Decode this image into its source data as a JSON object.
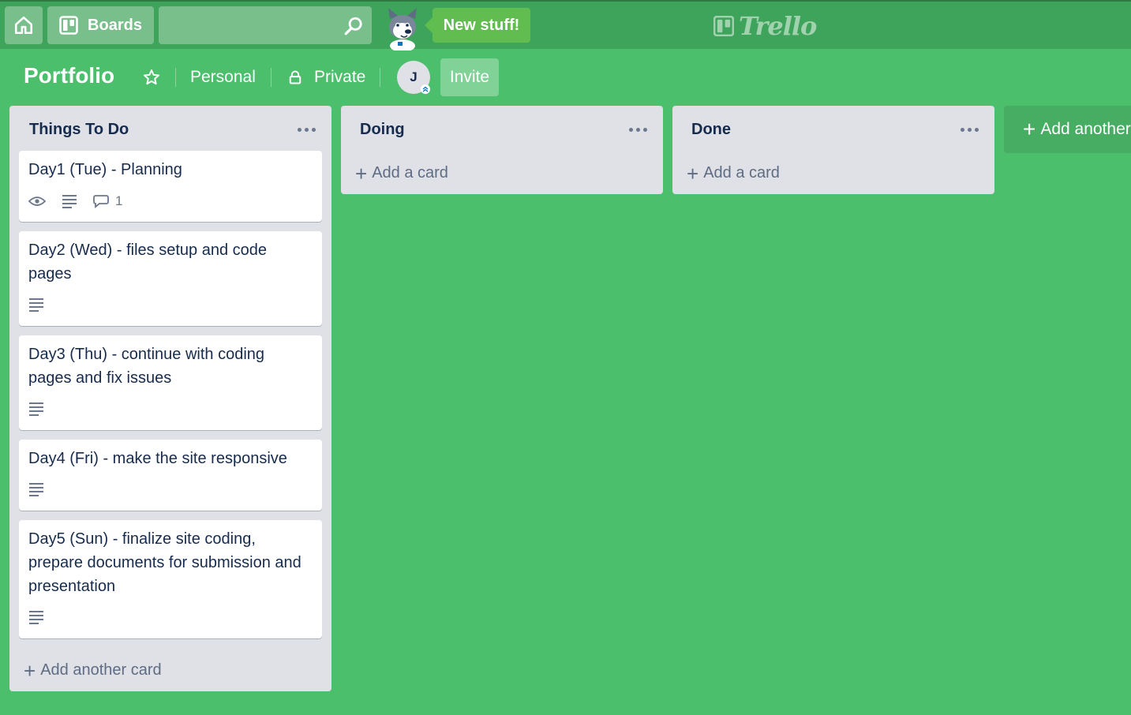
{
  "header": {
    "home_icon": "home-icon",
    "boards_label": "Boards",
    "search_placeholder": "",
    "new_stuff_label": "New stuff!",
    "logo_text": "Trello"
  },
  "board": {
    "title": "Portfolio",
    "team": "Personal",
    "visibility": "Private",
    "member_initial": "J",
    "invite_label": "Invite"
  },
  "lists": [
    {
      "title": "Things To Do",
      "cards": [
        {
          "title": "Day1 (Tue) - Planning",
          "badges": [
            "watch",
            "description",
            "comments"
          ],
          "comment_count": "1"
        },
        {
          "title": "Day2 (Wed) - files setup and code pages",
          "badges": [
            "description"
          ]
        },
        {
          "title": "Day3 (Thu) - continue with coding pages and fix issues",
          "badges": [
            "description"
          ]
        },
        {
          "title": "Day4 (Fri) - make the site responsive",
          "badges": [
            "description"
          ]
        },
        {
          "title": "Day5 (Sun) - finalize site coding, prepare documents for submission and presentation",
          "badges": [
            "description"
          ]
        }
      ],
      "add_label": "Add another card"
    },
    {
      "title": "Doing",
      "cards": [],
      "add_label": "Add a card"
    },
    {
      "title": "Done",
      "cards": [],
      "add_label": "Add a card"
    }
  ],
  "add_list_label": "Add another list",
  "colors": {
    "board_background": "#4bbf6b",
    "header_background": "#3fa45b",
    "list_background": "#dfe1e6",
    "new_stuff_badge": "#61bd4f"
  }
}
